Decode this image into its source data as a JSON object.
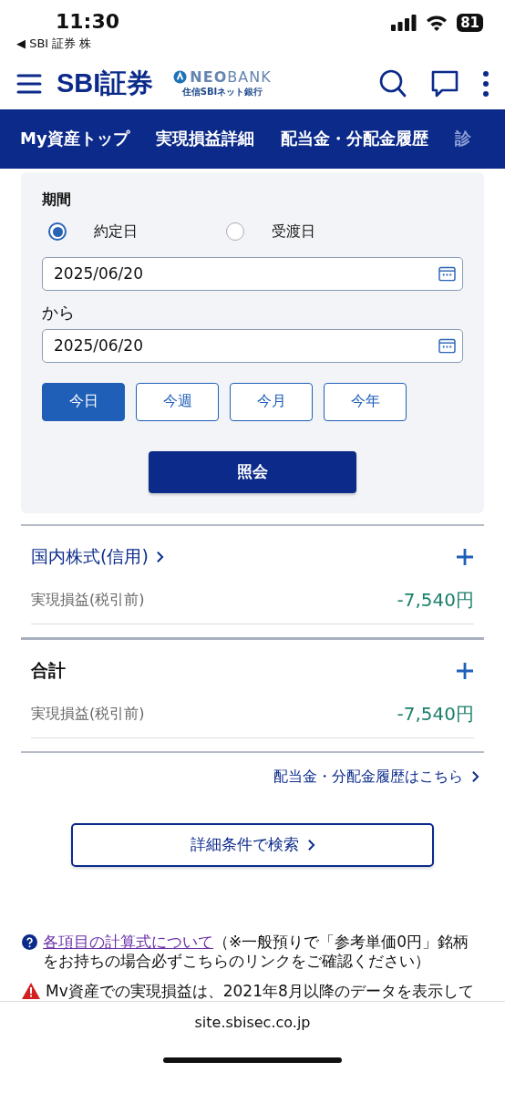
{
  "status_bar": {
    "time": "11:30",
    "back_app": "◀ SBI 証券 株",
    "battery": "81"
  },
  "header": {
    "logo": "SBI証券",
    "partner": {
      "name_bold": "NEO",
      "name_light": "BANK",
      "sub": "住信SBIネット銀行"
    }
  },
  "nav_tabs": [
    {
      "label": "My資産トップ"
    },
    {
      "label": "実現損益詳細"
    },
    {
      "label": "配当金・分配金履歴"
    },
    {
      "label": "診"
    }
  ],
  "filter": {
    "title": "期間",
    "radios": [
      {
        "label": "約定日",
        "selected": true
      },
      {
        "label": "受渡日",
        "selected": false
      }
    ],
    "date_from": "2025/06/20",
    "separator": "から",
    "date_to": "2025/06/20",
    "periods": [
      {
        "label": "今日",
        "selected": true
      },
      {
        "label": "今週",
        "selected": false
      },
      {
        "label": "今月",
        "selected": false
      },
      {
        "label": "今年",
        "selected": false
      }
    ],
    "submit": "照会"
  },
  "sections": [
    {
      "title": "国内株式(信用)",
      "kind": "link",
      "label": "実現損益(税引前)",
      "value": "-7,540円"
    },
    {
      "title": "合計",
      "kind": "plain",
      "label": "実現損益(税引前)",
      "value": "-7,540円"
    }
  ],
  "dividend_link": "配当金・分配金履歴はこちら",
  "search_button": "詳細条件で検索",
  "notes": [
    {
      "kind": "info",
      "link": "各項目の計算式について",
      "text": "（※一般預りで「参考単価0円」銘柄をお持ちの場合必ずこちらのリンクをご確認ください）"
    },
    {
      "kind": "warning",
      "text": "Mv資産での実現損益は、2021年8月以降のデータを表示して"
    }
  ],
  "browser": {
    "url": "site.sbisec.co.jp"
  }
}
